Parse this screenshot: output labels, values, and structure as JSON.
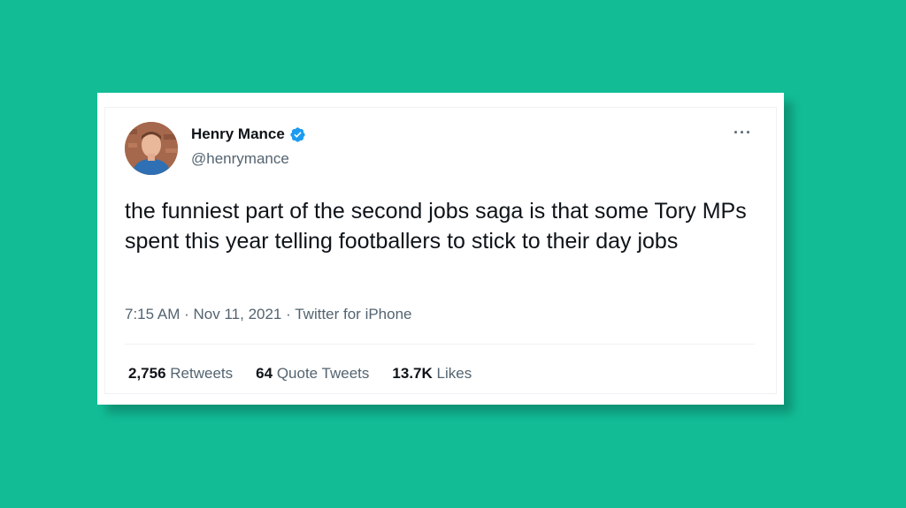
{
  "colors": {
    "background": "#12bd96",
    "card": "#ffffff",
    "text_primary": "#0f1419",
    "text_secondary": "#536471",
    "verified_blue": "#1d9bf0"
  },
  "user": {
    "display_name": "Henry Mance",
    "handle": "@henrymance",
    "verified": true
  },
  "tweet": {
    "text": "the funniest part of the second jobs saga is that some Tory MPs spent this year telling footballers to stick to their day jobs",
    "time": "7:15 AM",
    "date": "Nov 11, 2021",
    "source": "Twitter for iPhone",
    "separator": "·"
  },
  "menu": {
    "more_label": "···"
  },
  "stats": {
    "retweets": {
      "count": "2,756",
      "label": "Retweets"
    },
    "quotes": {
      "count": "64",
      "label": "Quote Tweets"
    },
    "likes": {
      "count": "13.7K",
      "label": "Likes"
    }
  }
}
